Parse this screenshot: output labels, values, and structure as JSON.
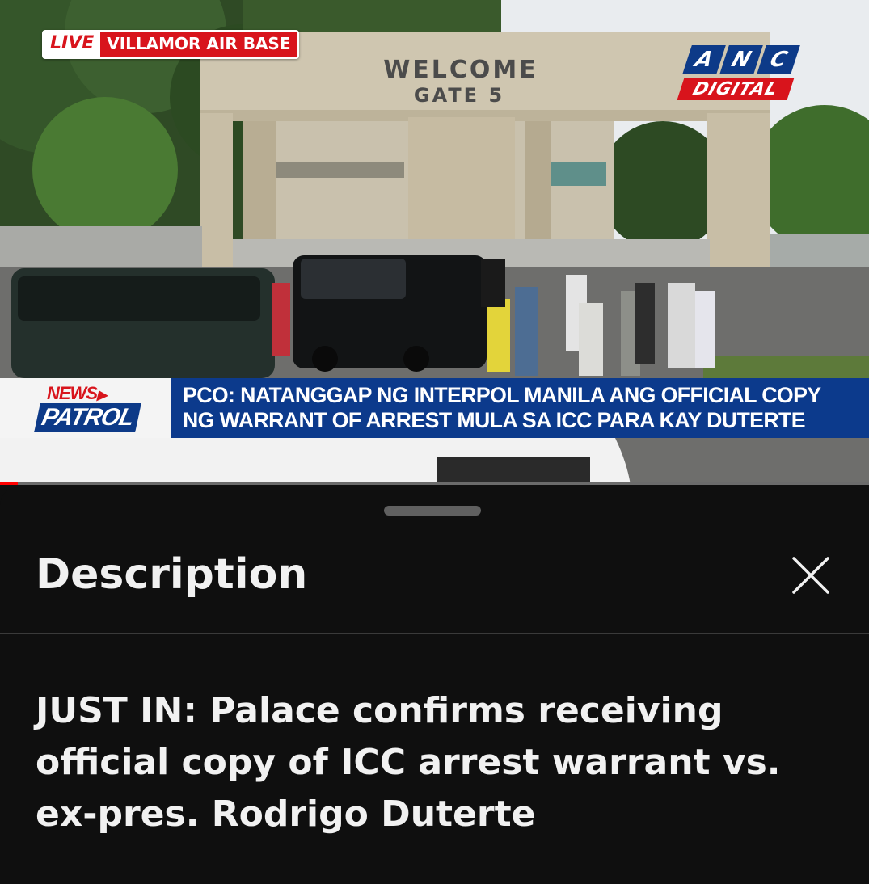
{
  "video": {
    "live_label": "LIVE",
    "location": "VILLAMOR AIR BASE",
    "gate_sign_line1": "WELCOME",
    "gate_sign_line2": "GATE 5",
    "channel_letters": [
      "A",
      "N",
      "C"
    ],
    "channel_sub": "DIGITAL",
    "program_top": "NEWS",
    "program_bottom": "PATROL",
    "headline_line1": "PCO: NATANGGAP NG INTERPOL MANILA ANG OFFICIAL COPY",
    "headline_line2": "NG WARRANT OF ARREST MULA SA ICC PARA KAY DUTERTE",
    "progress_fraction": 0.02,
    "colors": {
      "live_red": "#d8141c",
      "anc_blue": "#0d3a88",
      "progress_red": "#ff0000"
    }
  },
  "sheet": {
    "title": "Description",
    "close_icon": "close-icon",
    "description": "JUST IN: Palace confirms receiving official copy of ICC arrest warrant vs. ex-pres. Rodrigo Duterte"
  }
}
